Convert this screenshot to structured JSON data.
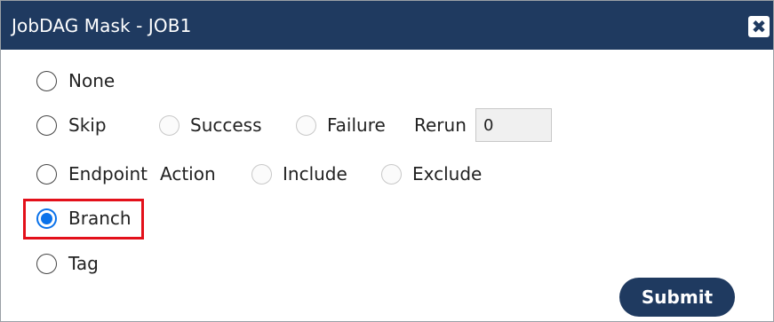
{
  "dialog": {
    "title": "JobDAG Mask - JOB1",
    "close_symbol": "✖"
  },
  "options": {
    "none": {
      "label": "None",
      "checked": false
    },
    "skip": {
      "label": "Skip",
      "checked": false,
      "sub_success": "Success",
      "sub_failure": "Failure",
      "rerun_label": "Rerun",
      "rerun_value": "0"
    },
    "endpoint": {
      "label": "Endpoint",
      "action_label": "Action",
      "sub_include": "Include",
      "sub_exclude": "Exclude",
      "checked": false
    },
    "branch": {
      "label": "Branch",
      "checked": true
    },
    "tag": {
      "label": "Tag",
      "checked": false
    }
  },
  "submit_label": "Submit",
  "colors": {
    "header_bg": "#1f3a60",
    "highlight": "#e3101a",
    "radio_checked": "#0a72ea"
  }
}
